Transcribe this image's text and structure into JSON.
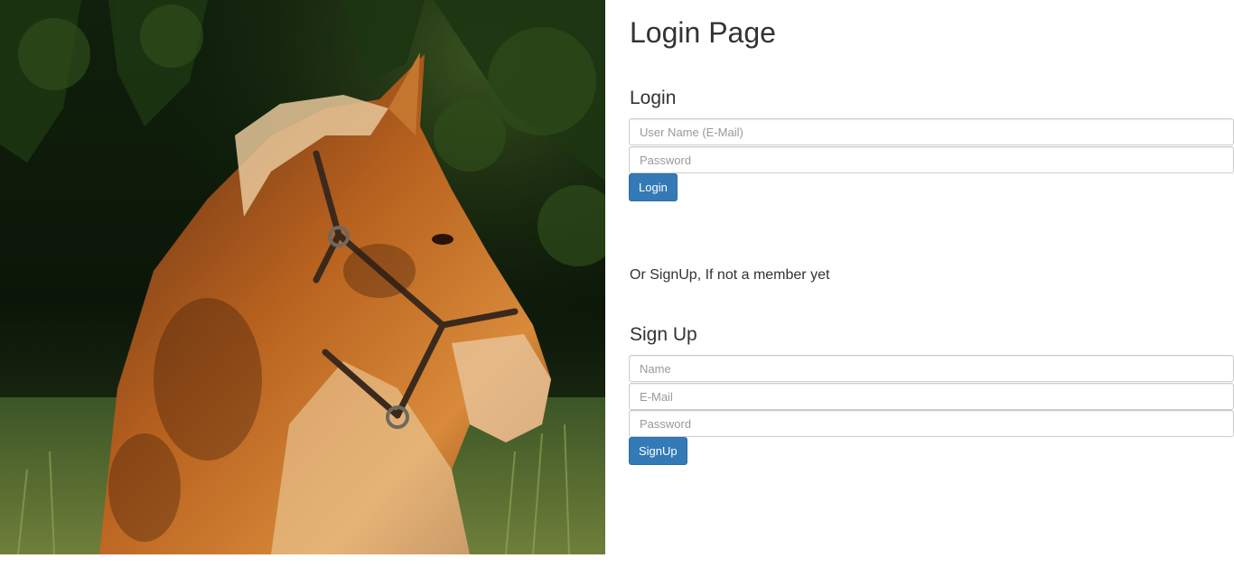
{
  "page": {
    "title": "Login Page"
  },
  "login": {
    "heading": "Login",
    "username_placeholder": "User Name (E-Mail)",
    "username_value": "",
    "password_placeholder": "Password",
    "password_value": "",
    "button_label": "Login"
  },
  "divider_text": "Or SignUp, If not a member yet",
  "signup": {
    "heading": "Sign Up",
    "name_placeholder": "Name",
    "name_value": "",
    "email_placeholder": "E-Mail",
    "email_value": "",
    "password_placeholder": "Password",
    "password_value": "",
    "button_label": "SignUp"
  },
  "colors": {
    "primary_button": "#337ab7",
    "primary_button_border": "#2e6da4",
    "text": "#333333",
    "input_border": "#cccccc"
  }
}
